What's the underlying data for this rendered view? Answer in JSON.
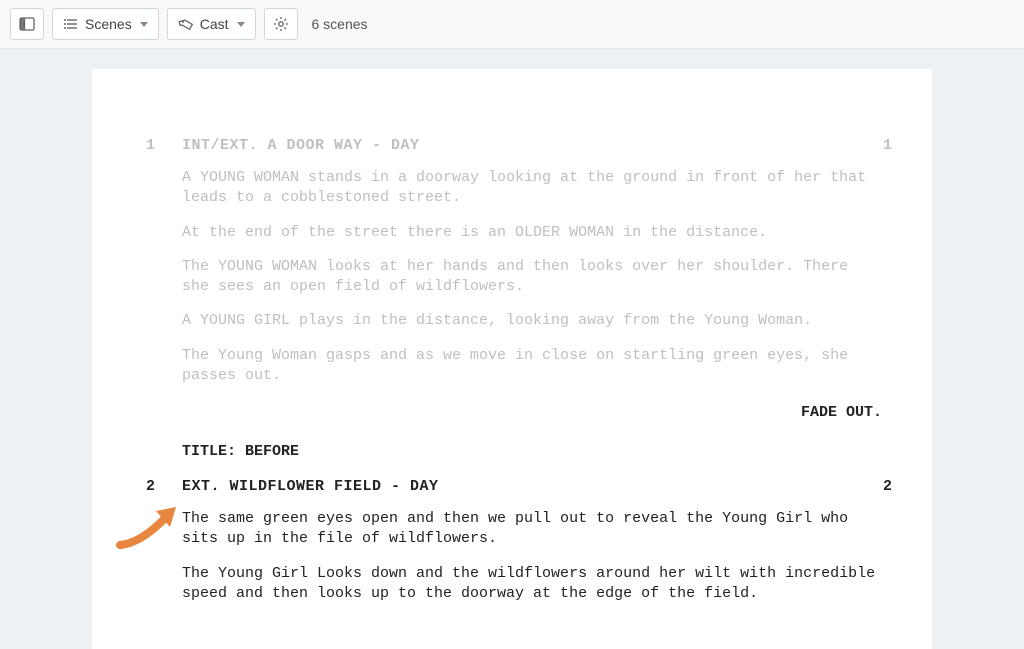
{
  "toolbar": {
    "scenes_label": "Scenes",
    "cast_label": "Cast",
    "scene_count": "6 scenes"
  },
  "script": {
    "scene1": {
      "num_left": "1",
      "num_right": "1",
      "heading": "INT/EXT. A DOOR WAY - DAY",
      "actions": [
        "A YOUNG WOMAN stands in a doorway looking at the ground in front of her that leads to a cobblestoned street.",
        "At the end of the street there is an OLDER WOMAN in the distance.",
        "The YOUNG WOMAN looks at her hands and then looks over her shoulder. There she sees an open field of wildflowers.",
        "A YOUNG GIRL plays in the distance, looking away from the Young Woman.",
        "The Young Woman gasps and as we move in close on startling green eyes, she passes out."
      ]
    },
    "transition1": "FADE OUT.",
    "title_card": "TITLE: BEFORE",
    "scene2": {
      "num_left": "2",
      "num_right": "2",
      "heading": "EXT. WILDFLOWER FIELD - DAY",
      "actions": [
        "The same green eyes open and then we pull out to reveal the Young Girl who sits up in the file of wildflowers.",
        "The Young Girl Looks down and the wildflowers around her wilt with incredible speed and then looks up to the doorway at the edge of the field."
      ]
    }
  }
}
